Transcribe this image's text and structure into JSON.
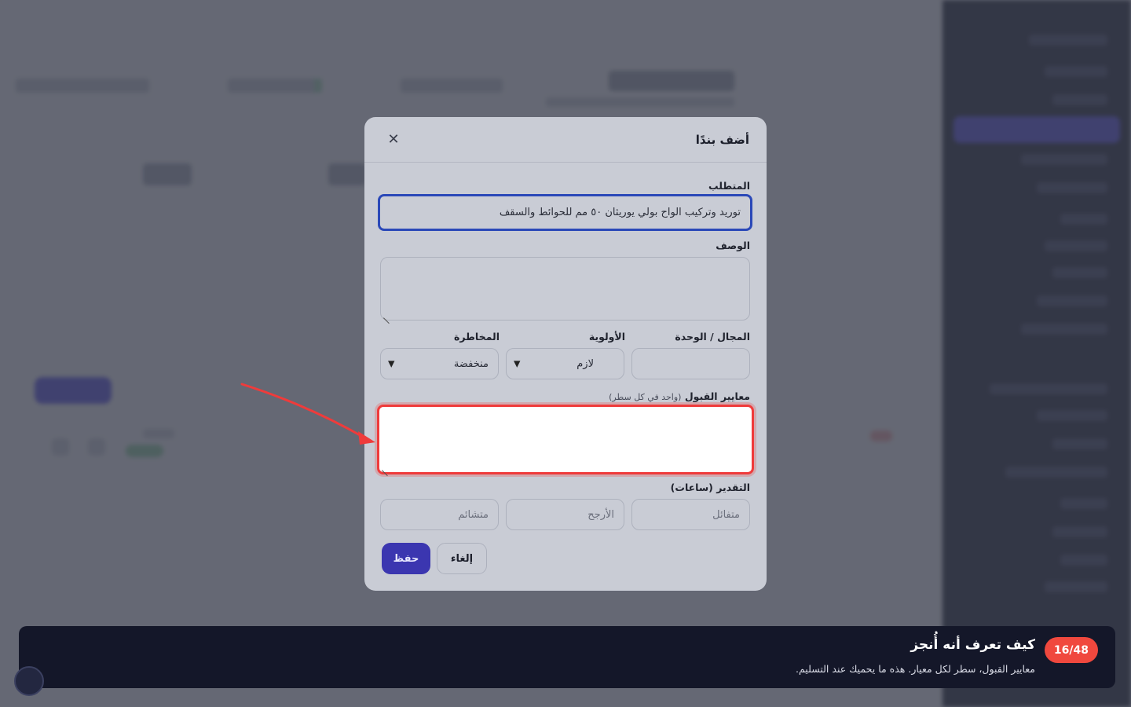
{
  "modal": {
    "title": "أضف بندًا",
    "close_icon": "close-icon",
    "requirement": {
      "label": "المتطلب",
      "value": "توريد وتركيب الواح بولي يوريثان ٥٠ مم للحوائط والسقف"
    },
    "description": {
      "label": "الوصف",
      "value": ""
    },
    "domain": {
      "label": "المجال / الوحدة",
      "value": ""
    },
    "priority": {
      "label": "الأولوية",
      "value": "لازم"
    },
    "risk": {
      "label": "المخاطرة",
      "value": "منخفضة"
    },
    "acceptance": {
      "label": "معايير القبول",
      "hint": "(واحد في كل سطر)",
      "value": ""
    },
    "estimate": {
      "label": "التقدير (ساعات)",
      "optimistic_placeholder": "متفائل",
      "likely_placeholder": "الأرجح",
      "pessimistic_placeholder": "متشائم"
    },
    "buttons": {
      "save": "حفظ",
      "cancel": "إلغاء"
    }
  },
  "tour": {
    "step": "16/48",
    "title": "كيف تعرف أنه أُنجز",
    "text": "معايير القبول، سطر لكل معيار. هذه ما يحميك عند التسليم."
  },
  "colors": {
    "highlight": "#ef3b3b",
    "accent": "#3b36b0",
    "badge": "#f0483e",
    "banner": "#141729"
  }
}
